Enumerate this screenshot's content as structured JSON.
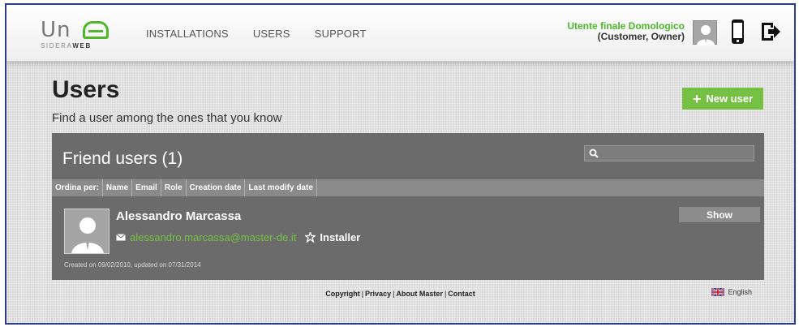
{
  "logo": {
    "word": "UNA",
    "sub_prefix": "SIDERA",
    "sub_bold": "WEB"
  },
  "nav": [
    "INSTALLATIONS",
    "USERS",
    "SUPPORT"
  ],
  "account": {
    "name": "Utente finale Domologico",
    "role": "(Customer, Owner)"
  },
  "page": {
    "title": "Users",
    "subtitle": "Find a user among the ones that you know",
    "new_user_label": "New user"
  },
  "panel": {
    "title": "Friend users (1)",
    "search_value": "",
    "sort": {
      "label": "Ordina per:",
      "columns": [
        "Name",
        "Email",
        "Role",
        "Creation date",
        "Last modify date"
      ]
    },
    "users": [
      {
        "name": "Alessandro Marcassa",
        "email": "alessandro.marcassa@master-de.it",
        "role": "Installer",
        "dates": "Created on 09/02/2010, updated on 07/31/2014",
        "show_label": "Show"
      }
    ]
  },
  "footer": {
    "links": [
      "Copyright",
      "Privacy",
      "About Master",
      "Contact"
    ],
    "language": "English"
  },
  "colors": {
    "accent_green": "#76c043",
    "panel": "#6b6b6b"
  },
  "icons": [
    "avatar-icon",
    "phone-icon",
    "logout-icon",
    "search-icon",
    "mail-icon",
    "installer-icon",
    "uk-flag-icon"
  ]
}
